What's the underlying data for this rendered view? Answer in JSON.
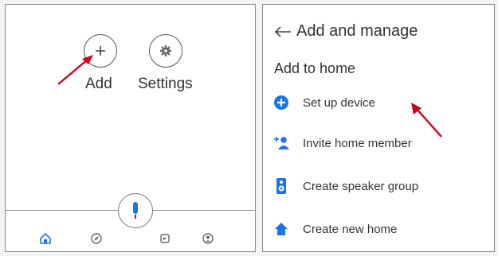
{
  "left": {
    "add_label": "Add",
    "settings_label": "Settings"
  },
  "right": {
    "back_title": "Add and manage",
    "section_title": "Add to home",
    "items": [
      {
        "label": "Set up device",
        "icon": "add-circle-icon"
      },
      {
        "label": "Invite home member",
        "icon": "person-add-icon"
      },
      {
        "label": "Create speaker group",
        "icon": "speaker-group-icon"
      },
      {
        "label": "Create new home",
        "icon": "home-icon"
      }
    ]
  },
  "colors": {
    "accent_blue": "#1a73e8",
    "annotation_red": "#d0021b"
  }
}
